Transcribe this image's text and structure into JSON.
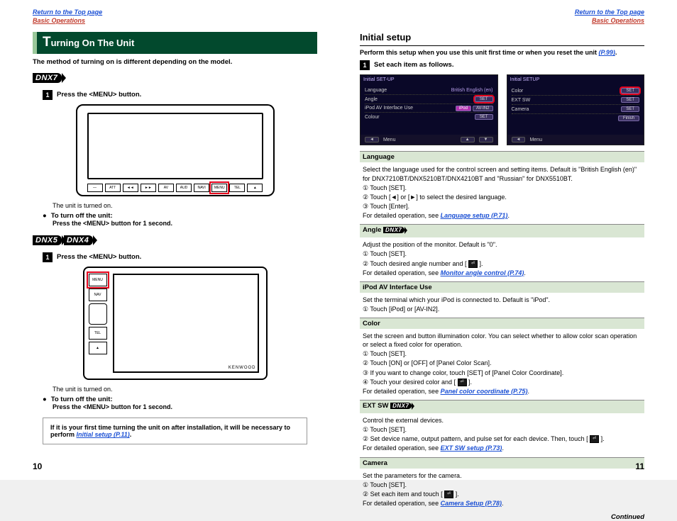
{
  "nav": {
    "return_top": "Return to the Top page",
    "basic_ops": "Basic Operations"
  },
  "left": {
    "title_cap": "T",
    "title_rest": "urning On The Unit",
    "intro": "The method of turning on is different depending on the model.",
    "dnx7": "DNX7",
    "dnx5": "DNX5",
    "dnx4": "DNX4",
    "step1_7": "Press the <MENU> button.",
    "step1_54": "Press the <MENU> button.",
    "on_note": "The unit is turned on.",
    "off_head": "To turn off the unit:",
    "off_text": "Press the <MENU> button for 1 second.",
    "note_box": "If it is your first time turning the unit on after installation, it will be necessary to perform ",
    "note_link": "Initial setup (P.11)",
    "dnx7_buttons": [
      "—",
      "ATT",
      "◄◄",
      "►►",
      "AV",
      "AUD",
      "NAVI",
      "MENU",
      "TEL",
      "▲"
    ],
    "dnx54_buttons": [
      "MENU",
      "NAV",
      "TEL",
      "▲"
    ],
    "brand": "KENWOOD",
    "pagenum": "10"
  },
  "right": {
    "h2": "Initial setup",
    "intro": "Perform this setup when you use this unit first time or when you reset the unit ",
    "intro_link": "(P.99)",
    "step1": "Set each item as follows.",
    "shot1": {
      "title": "Initial SET-UP",
      "rows": [
        {
          "k": "Language",
          "v": "British English (en)",
          "set": false
        },
        {
          "k": "Angle",
          "v": "",
          "set": true
        },
        {
          "k": "iPod AV Interface Use",
          "v": "",
          "pills": [
            "iPod",
            "AV-IN2"
          ]
        },
        {
          "k": "Colour",
          "v": "",
          "set": true
        }
      ],
      "bottom": [
        "◄",
        "Menu",
        "",
        "",
        "▲",
        "▼"
      ]
    },
    "shot2": {
      "title": "Initial SETUP",
      "rows": [
        {
          "k": "Color",
          "v": "",
          "set": true
        },
        {
          "k": "EXT SW",
          "v": "",
          "set": true
        },
        {
          "k": "Camera",
          "v": "",
          "set": true
        }
      ],
      "finish": "Finish",
      "bottom": [
        "◄",
        "Menu"
      ]
    },
    "sections": {
      "language": {
        "title": "Language",
        "body": "Select the language used for the control screen and setting items. Default is \"British English (en)\" for DNX7210BT/DNX5210BT/DNX4210BT and \"Russian\" for DNX5510BT.",
        "l1": "Touch [SET].",
        "l2a": "Touch [",
        "l2b": "] or [",
        "l2c": "] to select the desired language.",
        "l3": "Touch [Enter].",
        "detail": "For detailed operation, see ",
        "link": "Language setup (P.71)"
      },
      "angle": {
        "title": "Angle",
        "body": "Adjust the position of the monitor. Default is \"0\".",
        "l1": "Touch [SET].",
        "l2a": "Touch desired angle number and [ ",
        "l2b": " ].",
        "detail": "For detailed operation, see ",
        "link": "Monitor angle control (P.74)"
      },
      "ipod": {
        "title": "iPod AV Interface Use",
        "body": "Set the terminal which your iPod is connected to. Default is \"iPod\".",
        "l1": "Touch [iPod] or [AV-IN2]."
      },
      "color": {
        "title": "Color",
        "body": "Set the screen and button illumination color. You can select whether to allow color scan operation or select a fixed color for operation.",
        "l1": "Touch [SET].",
        "l2": "Touch [ON] or [OFF] of [Panel Color Scan].",
        "l3": "If you want to change color, touch [SET] of [Panel Color Coordinate].",
        "l4a": "Touch your desired color and [ ",
        "l4b": " ].",
        "detail": "For detailed operation, see ",
        "link": "Panel color coordinate (P.75)"
      },
      "extsw": {
        "title": "EXT SW",
        "body": "Control the external devices.",
        "l1": "Touch [SET].",
        "l2a": "Set device name, output pattern, and pulse set for each device. Then, touch [ ",
        "l2b": " ].",
        "detail": "For detailed operation, see ",
        "link": "EXT SW setup (P.73)"
      },
      "camera": {
        "title": "Camera",
        "body": "Set the parameters for the camera.",
        "l1": "Touch [SET].",
        "l2a": "Set each item and touch [ ",
        "l2b": " ].",
        "detail": "For detailed operation, see ",
        "link": "Camera Setup (P.78)"
      }
    },
    "continued": "Continued",
    "pagenum": "11"
  }
}
